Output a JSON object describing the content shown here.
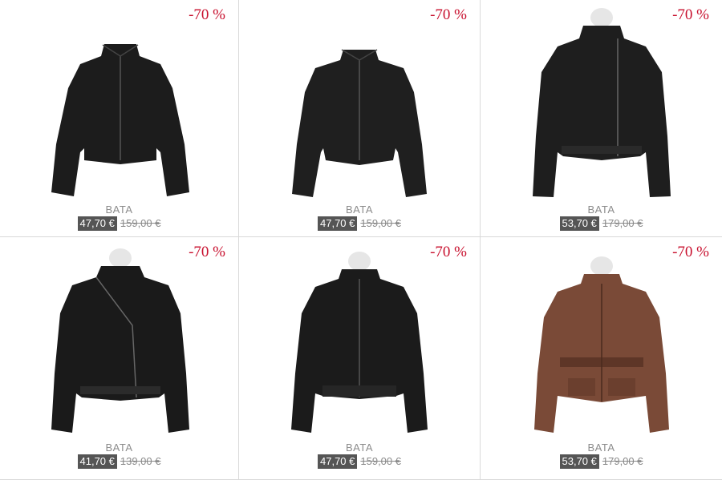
{
  "products": [
    {
      "discount": "-70 %",
      "brand": "BATA",
      "price": "47,70 €",
      "old_price": "159,00 €",
      "image": "black-leather-collar-jacket"
    },
    {
      "discount": "-70 %",
      "brand": "BATA",
      "price": "47,70 €",
      "old_price": "159,00 €",
      "image": "black-leather-jacket"
    },
    {
      "discount": "-70 %",
      "brand": "BATA",
      "price": "53,70 €",
      "old_price": "179,00 €",
      "image": "black-leather-asymmetric-zip-jacket"
    },
    {
      "discount": "-70 %",
      "brand": "BATA",
      "price": "41,70 €",
      "old_price": "139,00 €",
      "image": "black-leather-biker-jacket"
    },
    {
      "discount": "-70 %",
      "brand": "BATA",
      "price": "47,70 €",
      "old_price": "159,00 €",
      "image": "black-leather-bomber-jacket"
    },
    {
      "discount": "-70 %",
      "brand": "BATA",
      "price": "53,70 €",
      "old_price": "179,00 €",
      "image": "brown-leather-belted-safari-jacket"
    }
  ],
  "colors": {
    "discount": "#c8102e",
    "price_bg": "#555555",
    "leather_black": "#1c1c1c",
    "leather_brown": "#7a4a37"
  }
}
